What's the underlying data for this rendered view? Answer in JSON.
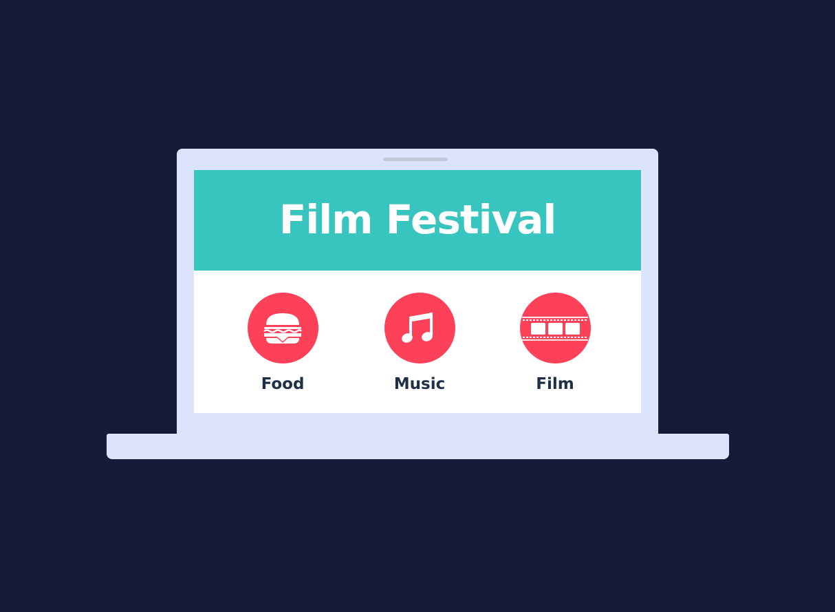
{
  "screen": {
    "title": "Film Festival",
    "header_color": "#39c5bf",
    "accent_color": "#fd4159",
    "categories": [
      {
        "label": "Food",
        "icon": "burger-icon"
      },
      {
        "label": "Music",
        "icon": "music-note-icon"
      },
      {
        "label": "Film",
        "icon": "film-strip-icon"
      }
    ]
  }
}
